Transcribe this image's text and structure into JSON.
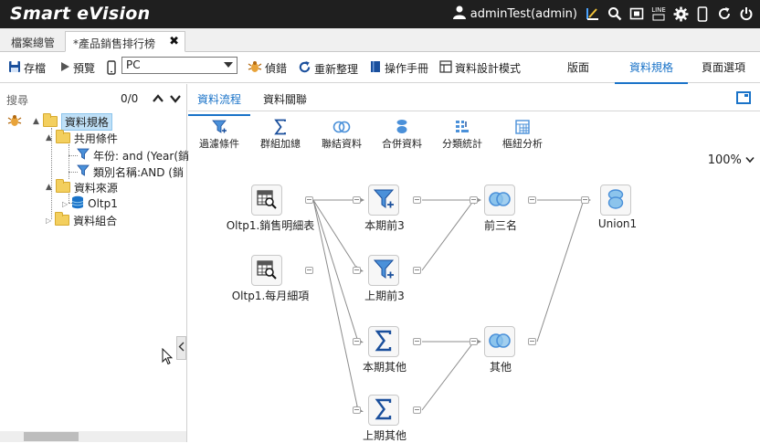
{
  "app": {
    "title": "Smart eVision",
    "user": "adminTest(admin)"
  },
  "top_icons": [
    "user-icon",
    "dashboard-icon",
    "search-icon",
    "screenshot-icon",
    "line-icon",
    "gear-icon",
    "mobile-icon",
    "refresh-icon",
    "power-icon"
  ],
  "line_label": "LINE",
  "doc_tabs": [
    {
      "label": "檔案總管"
    },
    {
      "label": "*產品銷售排行榜",
      "close": "✖"
    }
  ],
  "toolbar": {
    "save": "存檔",
    "preview": "預覽",
    "device": "PC",
    "debug": "偵錯",
    "reorganize": "重新整理",
    "manual": "操作手冊",
    "design_mode": "資料設計模式",
    "right_tabs": [
      "版面",
      "資料規格",
      "頁面選項"
    ]
  },
  "left": {
    "search_placeholder": "搜尋",
    "count": "0/0",
    "tree": {
      "root": "資料規格",
      "common": "共用條件",
      "cond1": "年份: and (Year(銷",
      "cond2": "類別名稱:AND (銷",
      "source": "資料來源",
      "source_item": "Oltp1",
      "combo": "資料組合"
    }
  },
  "main": {
    "sub_tabs": [
      "資料流程",
      "資料關聯"
    ],
    "ops": [
      "過濾條件",
      "群組加總",
      "聯結資料",
      "合併資料",
      "分類統計",
      "樞紐分析"
    ],
    "zoom": "100%",
    "nodes": {
      "table1": "Oltp1.銷售明細表",
      "table2": "Oltp1.每月細項",
      "filter1": "本期前3",
      "filter2": "上期前3",
      "join1": "前三名",
      "sum1": "本期其他",
      "sum2": "上期其他",
      "join2": "其他",
      "union": "Union1"
    }
  },
  "colors": {
    "accent": "#1a73c8",
    "topbar": "#1f1f1f",
    "node_icon": "#4a90d9"
  }
}
